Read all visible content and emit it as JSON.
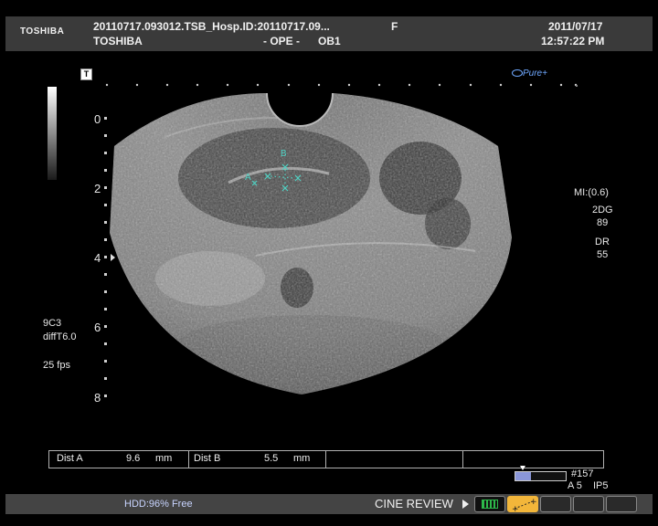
{
  "header": {
    "brand": "TOSHIBA",
    "line1_left": "20110717.093012.TSB_Hosp.ID:20110717.09...",
    "line1_sex": "F",
    "line1_date": "2011/07/17",
    "line2_left": "TOSHIBA",
    "line2_mid": "- OPE -",
    "line2_mode": "OB1",
    "line2_time": "12:57:22 PM"
  },
  "logo": {
    "text": "Pure+"
  },
  "t_marker": "T",
  "depth_labels": [
    "0",
    "2",
    "4",
    "6",
    "8"
  ],
  "right_params": {
    "mi": "MI:(0.6)",
    "mode": "2DG",
    "gain": "89",
    "dr_label": "DR",
    "dr_value": "55"
  },
  "left_params": {
    "probe": "9C3",
    "preset": "diffT6.0",
    "fps": "25 fps"
  },
  "caliper_labels": {
    "a": "A",
    "b": "B"
  },
  "measurements": [
    {
      "label": "Dist  A",
      "value": "9.6",
      "unit": "mm"
    },
    {
      "label": "Dist  B",
      "value": "5.5",
      "unit": "mm"
    }
  ],
  "cine": {
    "frame": "#157",
    "subline": "A 5",
    "ip": "IP5",
    "progress": 0.3
  },
  "footer": {
    "hdd": "HDD:96% Free",
    "cine_review": "CINE REVIEW"
  },
  "colors": {
    "caliper": "#4fd2c4",
    "header_bg": "#3a3a3a",
    "footer_bg": "#444444",
    "cine_green": "#2db84a",
    "cine_yellow": "#f2b63a"
  }
}
